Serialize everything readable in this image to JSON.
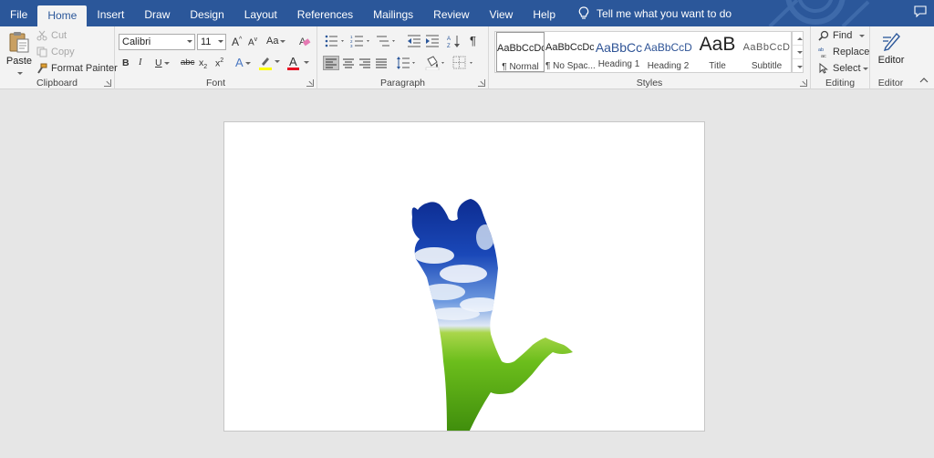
{
  "tabs": [
    {
      "label": "File"
    },
    {
      "label": "Home",
      "active": true
    },
    {
      "label": "Insert"
    },
    {
      "label": "Draw"
    },
    {
      "label": "Design"
    },
    {
      "label": "Layout"
    },
    {
      "label": "References"
    },
    {
      "label": "Mailings"
    },
    {
      "label": "Review"
    },
    {
      "label": "View"
    },
    {
      "label": "Help"
    }
  ],
  "tell_me": {
    "text": "Tell me what you want to do",
    "icon": "lightbulb-icon"
  },
  "clipboard": {
    "paste_label": "Paste",
    "cut_label": "Cut",
    "copy_label": "Copy",
    "format_painter_label": "Format Painter",
    "group_label": "Clipboard"
  },
  "font": {
    "font_name": "Calibri",
    "font_size": "11",
    "grow_label": "A",
    "shrink_label": "A",
    "case_label": "Aa",
    "bold": "B",
    "italic": "I",
    "underline": "U",
    "strike": "abc",
    "subscript": "x",
    "superscript": "x",
    "subscript_mark": "2",
    "superscript_mark": "2",
    "effects": "A",
    "font_color": "A",
    "group_label": "Font"
  },
  "paragraph": {
    "group_label": "Paragraph",
    "pilcrow": "¶"
  },
  "styles": {
    "items": [
      {
        "sample": "AaBbCcDc",
        "name": "¶ Normal"
      },
      {
        "sample": "AaBbCcDc",
        "name": "¶ No Spac..."
      },
      {
        "sample": "AaBbCc",
        "name": "Heading 1"
      },
      {
        "sample": "AaBbCcD",
        "name": "Heading 2"
      },
      {
        "sample": "AaB",
        "name": "Title"
      },
      {
        "sample": "AaBbCcD",
        "name": "Subtitle"
      }
    ],
    "group_label": "Styles"
  },
  "editing": {
    "find_label": "Find",
    "replace_label": "Replace",
    "select_label": "Select",
    "group_label": "Editing"
  },
  "editor": {
    "button_label": "Editor",
    "group_label": "Editor"
  },
  "colors": {
    "accent": "#2b579a",
    "ribbon_bg": "#f3f3f3",
    "canvas_bg": "#e6e6e6",
    "font_color_bar": "#e81123",
    "highlight_bar": "#ffff00",
    "heading_blue": "#2f5496"
  },
  "document": {
    "image": "couple-silhouette-sky-grass"
  }
}
